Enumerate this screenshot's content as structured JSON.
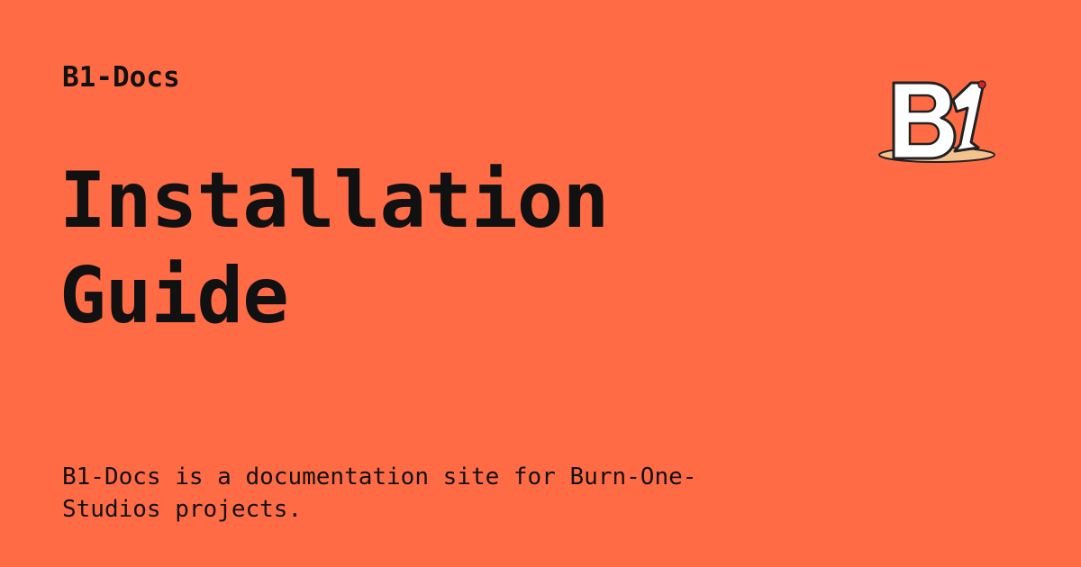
{
  "site": {
    "name": "B1-Docs"
  },
  "page": {
    "title": "Installation Guide",
    "description": "B1-Docs is a documentation site for Burn-One-Studios projects."
  },
  "logo": {
    "name": "b1-logo",
    "text": "B1"
  },
  "colors": {
    "background": "#FF6B45",
    "text": "#111111",
    "logo_fill": "#FFFFFF",
    "logo_outline": "#222222",
    "logo_base": "#F2C38F"
  }
}
